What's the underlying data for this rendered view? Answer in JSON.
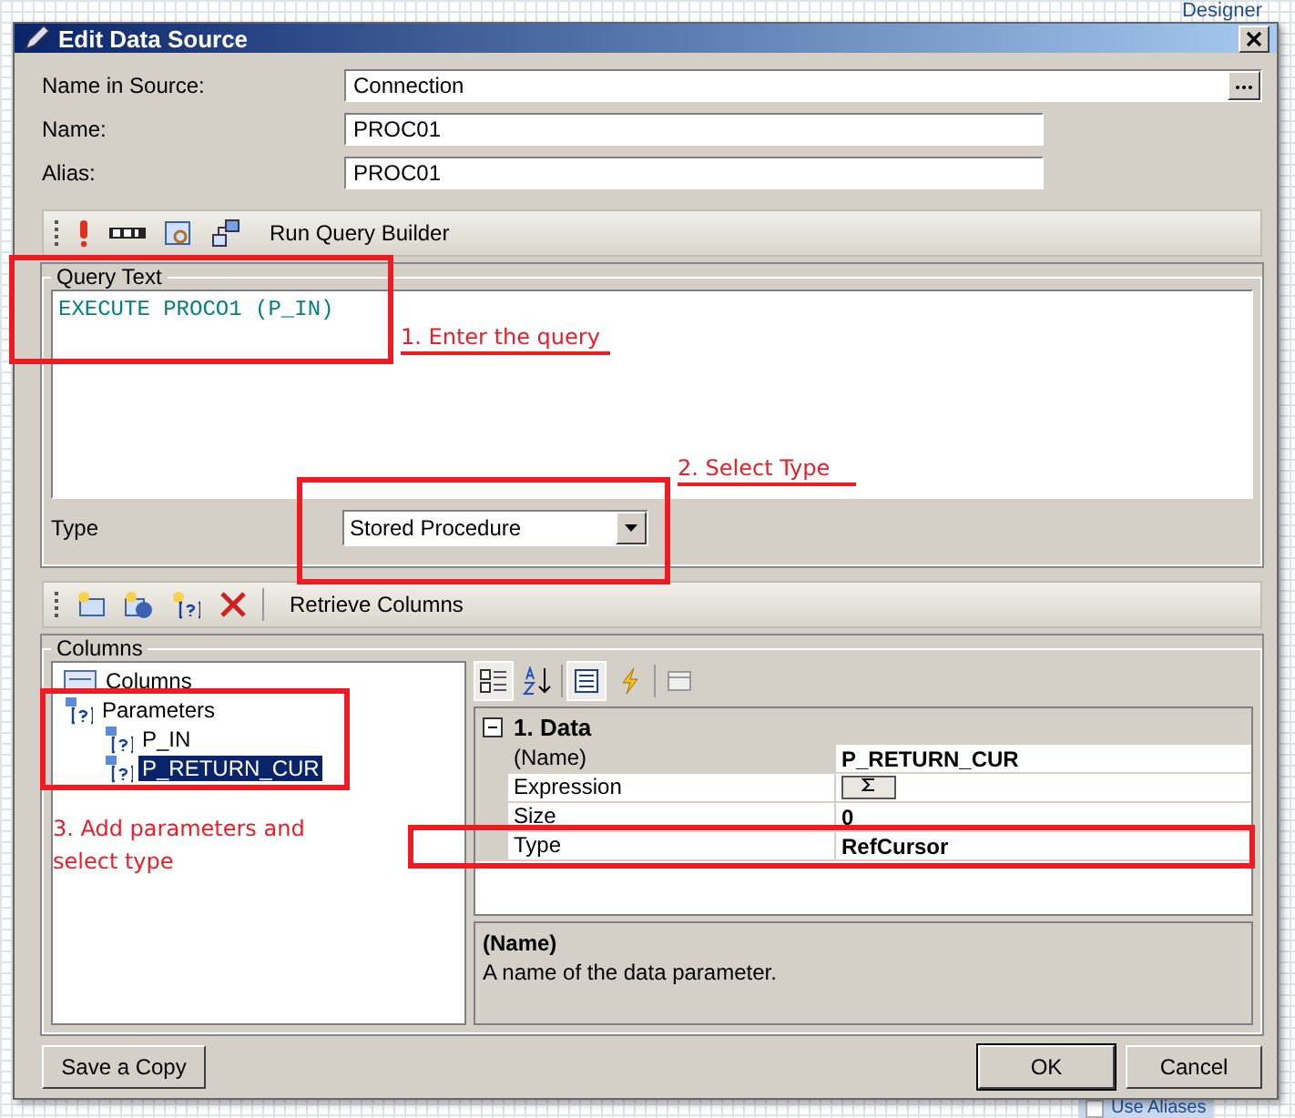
{
  "background_app": {
    "header_text": "Designer",
    "checkbox": {
      "label": "Use Aliases",
      "checked": false
    }
  },
  "window": {
    "title": "Edit Data Source"
  },
  "fields": [
    {
      "label": "Name in Source:",
      "value": "Connection",
      "kind": "browse"
    },
    {
      "label": "Name:",
      "value": "PROC01",
      "kind": "text"
    },
    {
      "label": "Alias:",
      "value": "PROC01",
      "kind": "text"
    }
  ],
  "query_toolbar": {
    "action": "Run Query Builder"
  },
  "query": {
    "group_title": "Query Text",
    "text": "EXECUTE PROCO1 (P_IN)",
    "type_label": "Type",
    "type_value": "Stored Procedure"
  },
  "columns_toolbar": {
    "action": "Retrieve Columns"
  },
  "columns": {
    "group_title": "Columns",
    "tree": [
      {
        "label": "Columns",
        "kind": "columns",
        "selected": false
      },
      {
        "label": "Parameters",
        "kind": "parameters",
        "selected": false,
        "children": [
          {
            "label": "P_IN",
            "kind": "parameter",
            "selected": false
          },
          {
            "label": "P_RETURN_CUR",
            "kind": "parameter",
            "selected": true
          }
        ]
      }
    ]
  },
  "properties": {
    "category": "1. Data",
    "expanded": true,
    "rows": [
      {
        "name": "(Name)",
        "value": "P_RETURN_CUR",
        "kind": "text"
      },
      {
        "name": "Expression",
        "kind": "expression"
      },
      {
        "name": "Size",
        "value": "0",
        "kind": "text"
      },
      {
        "name": "Type",
        "value": "RefCursor",
        "kind": "text"
      }
    ],
    "description_title": "(Name)",
    "description": "A name of the data parameter."
  },
  "buttons": [
    {
      "label": "Save a Copy",
      "kind": "left",
      "default": false
    },
    {
      "label": "OK",
      "kind": "right",
      "default": true
    },
    {
      "label": "Cancel",
      "kind": "right",
      "default": false
    }
  ],
  "annotations": [
    {
      "text": "1. Enter the query"
    },
    {
      "text": "2. Select Type"
    },
    {
      "text": "3. Add parameters and select type"
    }
  ]
}
